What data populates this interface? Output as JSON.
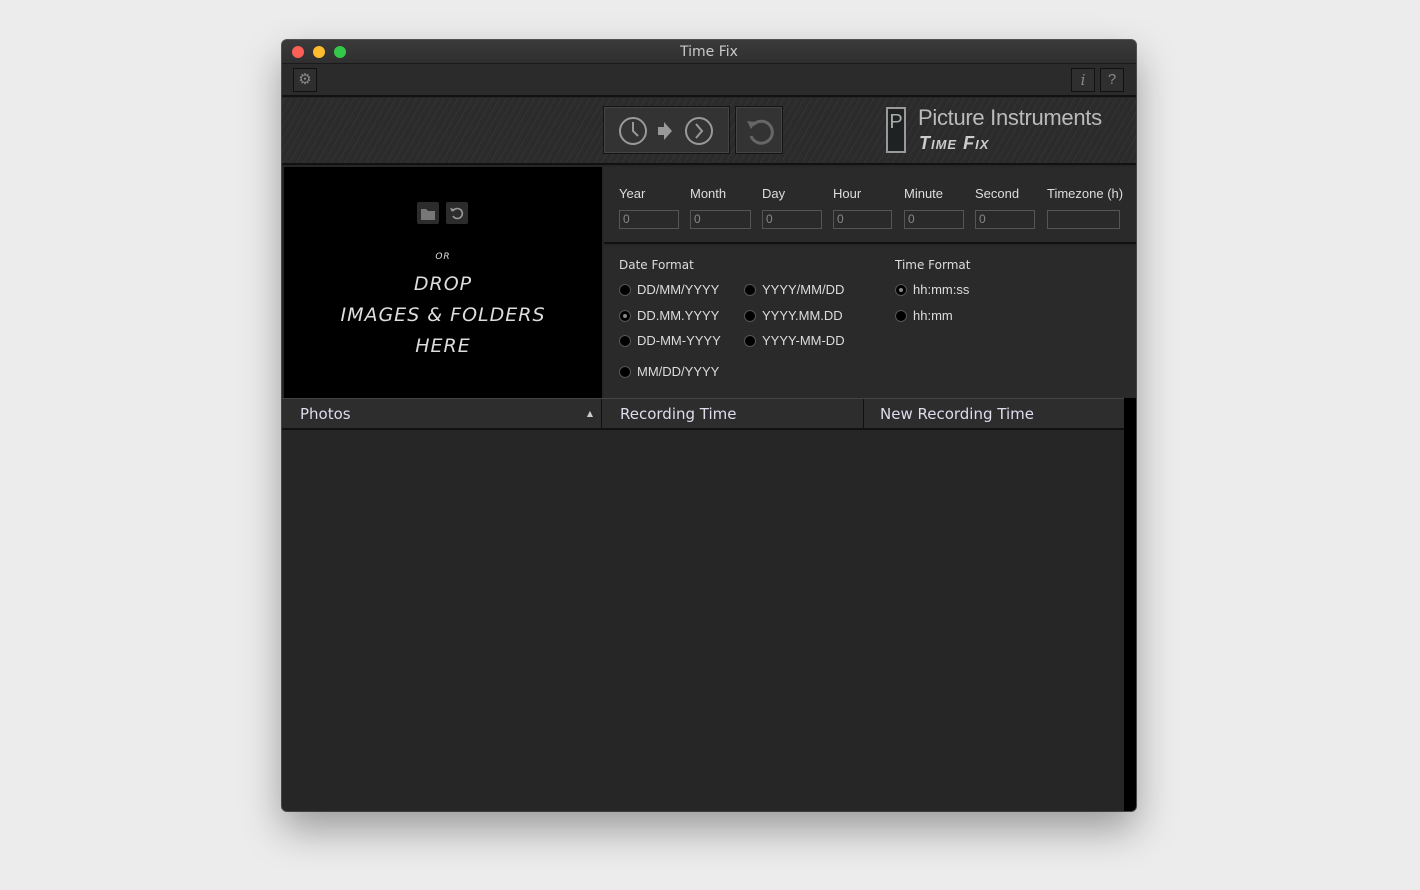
{
  "window": {
    "title": "Time Fix"
  },
  "toolbar": {
    "settings": "settings",
    "info": "i",
    "help": "?"
  },
  "brand": {
    "company": "Picture Instruments",
    "product": "Time Fix"
  },
  "drop": {
    "or": "OR",
    "line1": "DROP",
    "line2": "IMAGES & FOLDERS",
    "line3": "HERE"
  },
  "fields": [
    {
      "label": "Year",
      "value": "0"
    },
    {
      "label": "Month",
      "value": "0"
    },
    {
      "label": "Day",
      "value": "0"
    },
    {
      "label": "Hour",
      "value": "0"
    },
    {
      "label": "Minute",
      "value": "0"
    },
    {
      "label": "Second",
      "value": "0"
    },
    {
      "label": "Timezone (h)",
      "value": ""
    }
  ],
  "date_format": {
    "title": "Date Format",
    "options": [
      "DD/MM/YYYY",
      "DD.MM.YYYY",
      "DD-MM-YYYY",
      "MM/DD/YYYY",
      "YYYY/MM/DD",
      "YYYY.MM.DD",
      "YYYY-MM-DD"
    ],
    "selected": "DD.MM.YYYY"
  },
  "time_format": {
    "title": "Time Format",
    "options": [
      "hh:mm:ss",
      "hh:mm"
    ],
    "selected": "hh:mm:ss"
  },
  "table": {
    "columns": [
      "Photos",
      "Recording Time",
      "New Recording Time"
    ]
  }
}
